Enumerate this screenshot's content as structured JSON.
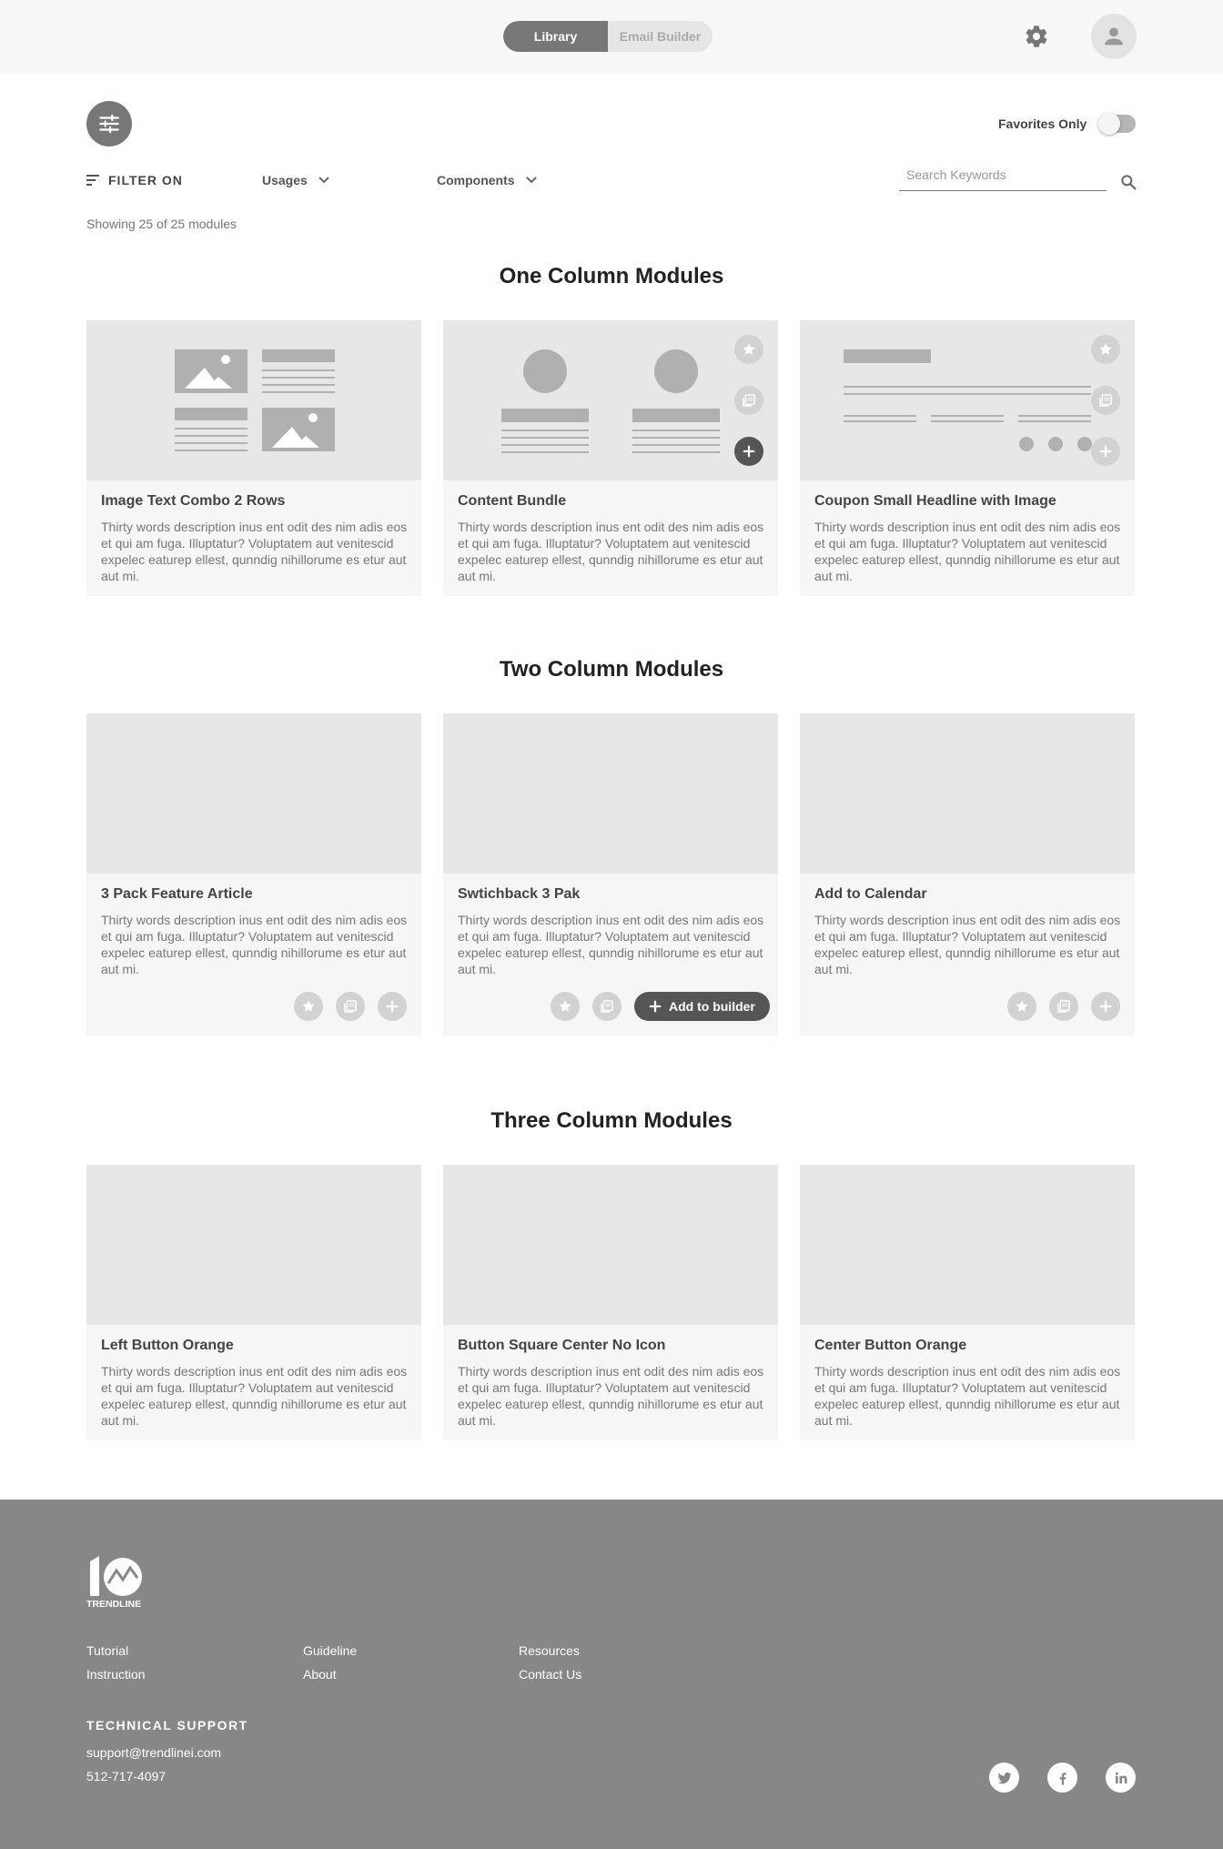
{
  "header": {
    "tabs": [
      {
        "label": "Library",
        "active": true
      },
      {
        "label": "Email Builder",
        "active": false
      }
    ]
  },
  "toolbar": {
    "favorites_label": "Favorites Only",
    "favorites_on": false,
    "filter_label": "FILTER ON",
    "usages_label": "Usages",
    "components_label": "Components",
    "search_placeholder": "Search Keywords",
    "showing_text": "Showing 25 of 25 modules"
  },
  "sections": [
    {
      "title": "One Column Modules",
      "cards": [
        {
          "title": "Image Text Combo 2 Rows",
          "desc": "Thirty words description inus ent odit des nim adis eos et qui am fuga. Illuptatur? Voluptatem aut venitescid expelec eaturep ellest, qunndig nihillorume es etur aut aut mi."
        },
        {
          "title": "Content Bundle",
          "desc": "Thirty words description inus ent odit des nim adis eos et qui am fuga. Illuptatur? Voluptatem aut venitescid expelec eaturep ellest, qunndig nihillorume es etur aut aut mi."
        },
        {
          "title": "Coupon Small Headline with Image",
          "desc": "Thirty words description inus ent odit des nim adis eos et qui am fuga. Illuptatur? Voluptatem aut venitescid expelec eaturep ellest, qunndig nihillorume es etur aut aut mi."
        }
      ]
    },
    {
      "title": "Two Column Modules",
      "cards": [
        {
          "title": "3 Pack Feature Article",
          "desc": "Thirty words description inus ent odit des nim adis eos et qui am fuga. Illuptatur? Voluptatem aut venitescid expelec eaturep ellest, qunndig nihillorume es etur aut aut mi."
        },
        {
          "title": "Swtichback 3 Pak",
          "desc": "Thirty words description inus ent odit des nim adis eos et qui am fuga. Illuptatur? Voluptatem aut venitescid expelec eaturep ellest, qunndig nihillorume es etur aut aut mi.",
          "add_label": "Add to builder"
        },
        {
          "title": "Add to Calendar",
          "desc": "Thirty words description inus ent odit des nim adis eos et qui am fuga. Illuptatur? Voluptatem aut venitescid expelec eaturep ellest, qunndig nihillorume es etur aut aut mi."
        }
      ]
    },
    {
      "title": "Three Column Modules",
      "cards": [
        {
          "title": "Left Button Orange",
          "desc": "Thirty words description inus ent odit des nim adis eos et qui am fuga. Illuptatur? Voluptatem aut venitescid expelec eaturep ellest, qunndig nihillorume es etur aut aut mi."
        },
        {
          "title": "Button Square Center No Icon",
          "desc": "Thirty words description inus ent odit des nim adis eos et qui am fuga. Illuptatur? Voluptatem aut venitescid expelec eaturep ellest, qunndig nihillorume es etur aut aut mi."
        },
        {
          "title": "Center Button Orange",
          "desc": "Thirty words description inus ent odit des nim adis eos et qui am fuga. Illuptatur? Voluptatem aut venitescid expelec eaturep ellest, qunndig nihillorume es etur aut aut mi."
        }
      ]
    }
  ],
  "footer": {
    "logo_text": "TRENDLINE",
    "links": [
      "Tutorial",
      "Instruction",
      "Guideline",
      "About",
      "Resources",
      "Contact Us"
    ],
    "support_title": "TECHNICAL SUPPORT",
    "email": "support@trendlinei.com",
    "phone": "512-717-4097",
    "social": [
      "twitter-icon",
      "facebook-icon",
      "linkedin-icon"
    ]
  },
  "colors": {
    "header_bg": "#f7f7f7",
    "accent_dark": "#555555",
    "card_bg": "#f6f6f6",
    "thumb_bg": "#e7e7e7",
    "footer_bg": "#878787"
  }
}
